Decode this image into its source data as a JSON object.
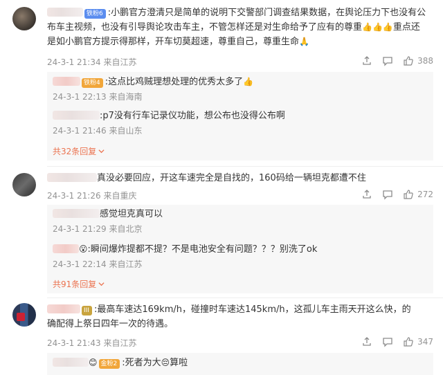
{
  "comments": [
    {
      "text_line1": ":小鹏官方澄清只是简单的说明下交警部门调查结果数据，在舆论压力下也没有公",
      "text_line2": "布车主视频，也没有引导舆论攻击车主，不管怎样还是对生命给予了应有的尊重",
      "text_line2b": "重点还",
      "text_line3": "是如小鹏官方提示得那样，开车切莫超速，尊重自己，尊重生命",
      "badge": "铁粉6",
      "time": "24-3-1 21:34",
      "location": "来自江苏",
      "likes": "388",
      "replies": [
        {
          "text": ":这点比鸡贼理想处理的优秀太多了",
          "badge": "铁粉4",
          "time": "24-3-1 22:13",
          "location": "来自海南"
        },
        {
          "text": ":p7没有行车记录仪功能，想公布也没得公布啊",
          "time": "24-3-1 21:46",
          "location": "来自山东"
        }
      ],
      "more": "共32条回复"
    },
    {
      "text_line1": "真没必要回应，开这车速完全是自找的，160码给一辆坦克都遭不住",
      "time": "24-3-1 21:26",
      "location": "来自重庆",
      "likes": "272",
      "replies": [
        {
          "text": "感觉坦克真可以",
          "time": "24-3-1 21:29",
          "location": "来自北京"
        },
        {
          "text": ":瞬间爆炸提都不提？不是电池安全有问题？？？别洗了ok",
          "time": "24-3-1 22:14",
          "location": "来自江苏"
        }
      ],
      "more": "共91条回复"
    },
    {
      "text_line1": ":最高车速达169km/h，碰撞时车速达145km/h，这孤儿车主雨天开这么快，的",
      "text_line2": "确配得上祭日四年一次的待遇。",
      "badge": "III",
      "time": "24-3-1 21:43",
      "location": "来自江苏",
      "likes": "347",
      "replies": [
        {
          "text": ":死者为大",
          "text_b": "算啦",
          "badge": "金粉2"
        }
      ]
    }
  ],
  "icons": {
    "share": "share-icon",
    "comment": "comment-icon",
    "like": "thumbs-up-icon",
    "more": "chevron-down-icon"
  },
  "colors": {
    "link": "#eb7350",
    "meta": "#939393",
    "badge_blue": "#5b8def"
  }
}
